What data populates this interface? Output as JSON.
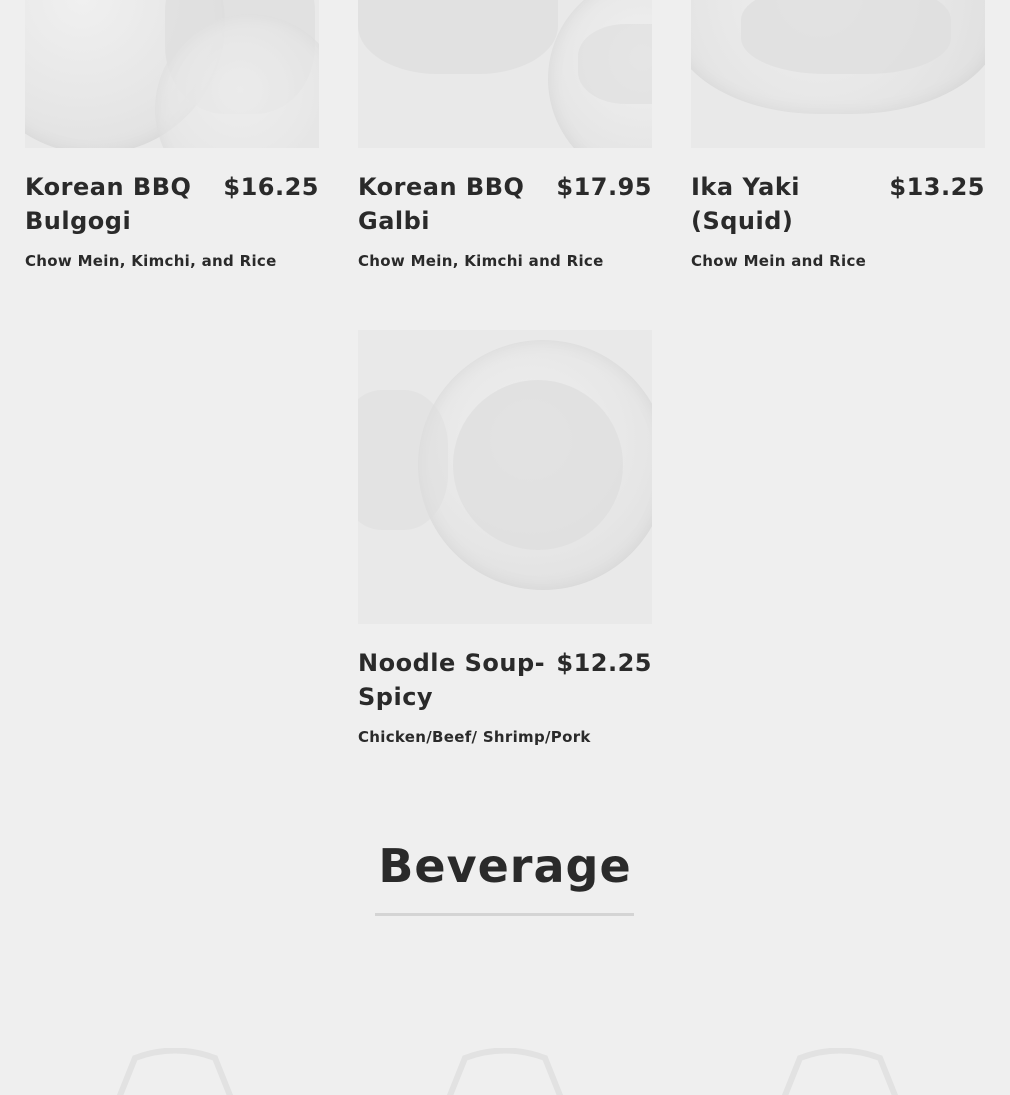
{
  "menu_items": [
    {
      "name": "Korean BBQ Bulgogi",
      "price": "$16.25",
      "description": "Chow Mein, Kimchi, and Rice"
    },
    {
      "name": "Korean BBQ Galbi",
      "price": "$17.95",
      "description": "Chow Mein, Kimchi and Rice"
    },
    {
      "name": "Ika Yaki (Squid)",
      "price": "$13.25",
      "description": "Chow Mein and Rice"
    },
    {
      "name": "Noodle Soup- Spicy",
      "price": "$12.25",
      "description": "Chicken/Beef/ Shrimp/Pork"
    }
  ],
  "beverage_section": {
    "title": "Beverage"
  },
  "colors": {
    "background": "#efefef",
    "text": "#2a2a2a",
    "divider": "#d4d4d4"
  }
}
